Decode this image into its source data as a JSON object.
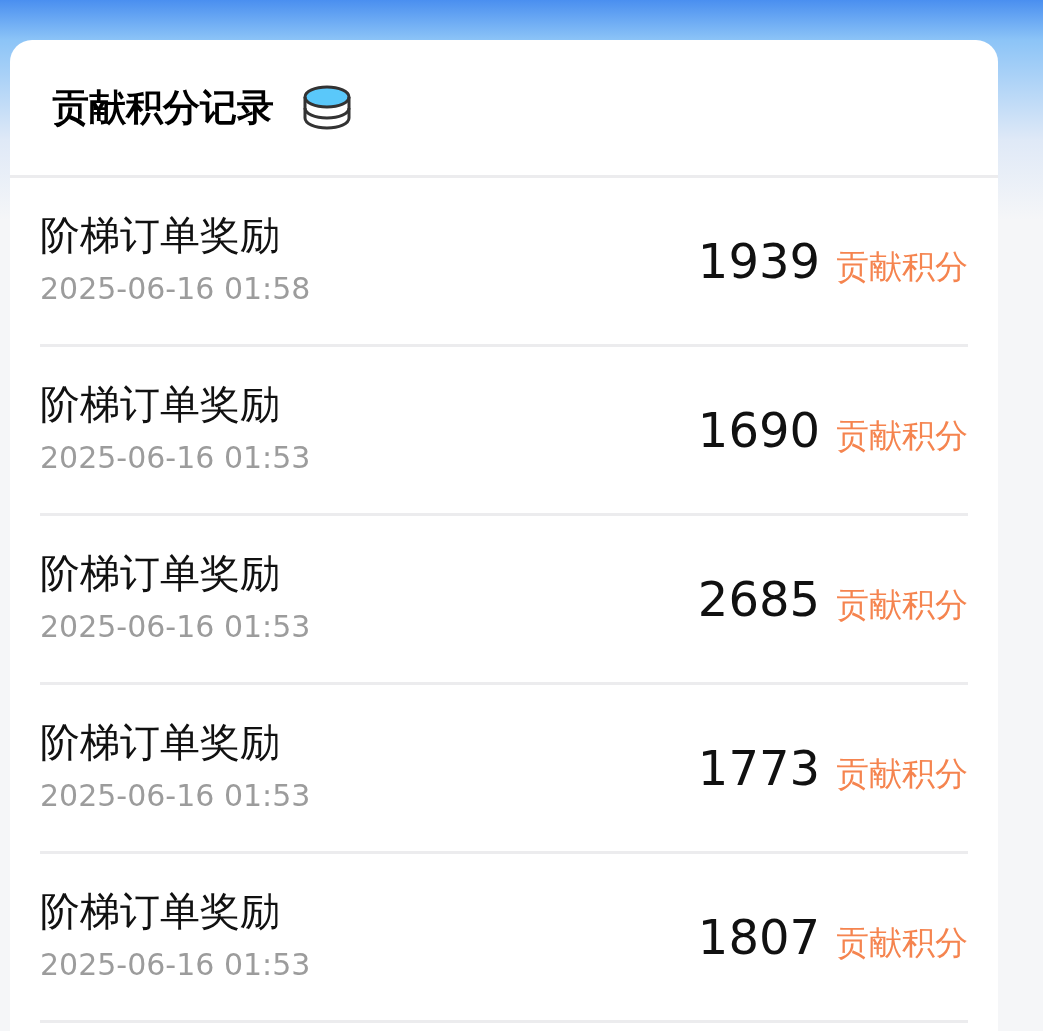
{
  "title": "贡献积分记录",
  "records": [
    {
      "name": "阶梯订单奖励",
      "time": "2025-06-16 01:58",
      "points": "1939",
      "unit": "贡献积分"
    },
    {
      "name": "阶梯订单奖励",
      "time": "2025-06-16 01:53",
      "points": "1690",
      "unit": "贡献积分"
    },
    {
      "name": "阶梯订单奖励",
      "time": "2025-06-16 01:53",
      "points": "2685",
      "unit": "贡献积分"
    },
    {
      "name": "阶梯订单奖励",
      "time": "2025-06-16 01:53",
      "points": "1773",
      "unit": "贡献积分"
    },
    {
      "name": "阶梯订单奖励",
      "time": "2025-06-16 01:53",
      "points": "1807",
      "unit": "贡献积分"
    }
  ]
}
